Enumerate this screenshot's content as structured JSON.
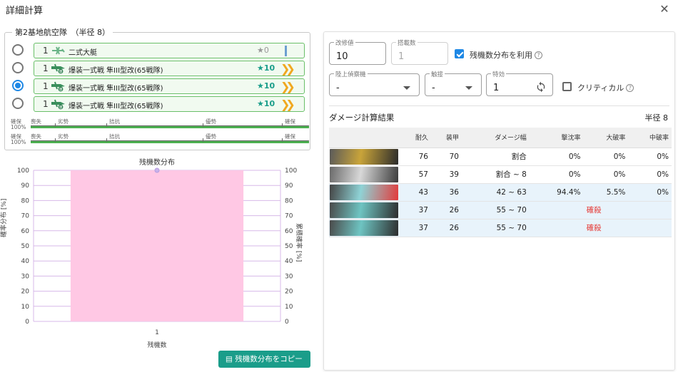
{
  "window": {
    "title": "詳細計算"
  },
  "fleet": {
    "legend": "第2基地航空隊　（半径 8）",
    "slots": [
      {
        "selected": false,
        "count": "1",
        "icon": "recon-plane-icon",
        "name": "二式大艇",
        "star": "0",
        "star_style": "grey",
        "proficiency": "",
        "proficiency_bar": true
      },
      {
        "selected": false,
        "count": "1",
        "icon": "fighter-bomber-icon",
        "name": "爆装一式戦 隼III型改(65戦隊)",
        "star": "10",
        "star_style": "teal",
        "proficiency": "❯❯",
        "proficiency_bar": false
      },
      {
        "selected": true,
        "count": "1",
        "icon": "fighter-bomber-icon",
        "name": "爆装一式戦 隼III型改(65戦隊)",
        "star": "10",
        "star_style": "teal",
        "proficiency": "❯❯",
        "proficiency_bar": false
      },
      {
        "selected": false,
        "count": "1",
        "icon": "fighter-bomber-icon",
        "name": "爆装一式戦 隼III型改(65戦隊)",
        "star": "10",
        "star_style": "teal",
        "proficiency": "❯❯",
        "proficiency_bar": false
      }
    ],
    "air_rows": [
      {
        "left": "確保",
        "left2": "100%",
        "labels": [
          "喪失",
          "劣勢",
          "拮抗",
          "優勢",
          "確保"
        ]
      },
      {
        "left": "確保",
        "left2": "100%",
        "labels": [
          "喪失",
          "劣勢",
          "拮抗",
          "優勢",
          "確保"
        ]
      }
    ]
  },
  "chart_data": {
    "type": "bar",
    "title": "残機数分布",
    "categories": [
      "1"
    ],
    "values": [
      100
    ],
    "xlabel": "残機数",
    "ylabel": "確率分布 [%]",
    "ylabel_right": "累積確率 [%]",
    "cumulative": [
      100
    ],
    "ylim": [
      0,
      100
    ],
    "yticks": [
      0,
      10,
      20,
      30,
      40,
      50,
      60,
      70,
      80,
      90,
      100
    ],
    "bar_color": "#ffc8e4",
    "grid_color": "#d7b8e8"
  },
  "copy_button": {
    "label": "残機数分布をコピー"
  },
  "settings": {
    "improvement": {
      "label": "改修値",
      "value": "10"
    },
    "slot_count": {
      "label": "搭載数",
      "value": "1"
    },
    "use_distribution": {
      "label": "残機数分布を利用",
      "checked": true
    },
    "recon": {
      "label": "陸上偵察機",
      "value": "-"
    },
    "contact": {
      "label": "触接",
      "value": "-"
    },
    "special": {
      "label": "特効",
      "value": "1"
    },
    "critical": {
      "label": "クリティカル",
      "checked": false
    }
  },
  "results": {
    "title": "ダメージ計算結果",
    "radius": "半径 8",
    "headers": [
      "",
      "耐久",
      "装甲",
      "ダメージ幅",
      "撃沈率",
      "大破率",
      "中破率"
    ],
    "rows": [
      {
        "banner": "enemy-1",
        "hp": "76",
        "armor": "70",
        "range": "割合",
        "sink": "0%",
        "heavy": "0%",
        "medium": "0%",
        "note": "",
        "highlight": false
      },
      {
        "banner": "enemy-2",
        "hp": "57",
        "armor": "39",
        "range": "割合 ~ 8",
        "sink": "0%",
        "heavy": "0%",
        "medium": "0%",
        "note": "",
        "highlight": false
      },
      {
        "banner": "enemy-3",
        "hp": "43",
        "armor": "36",
        "range": "42 ~ 63",
        "sink": "94.4%",
        "heavy": "5.5%",
        "medium": "0%",
        "note": "",
        "highlight": true
      },
      {
        "banner": "enemy-4",
        "hp": "37",
        "armor": "26",
        "range": "55 ~ 70",
        "sink": "",
        "heavy": "",
        "medium": "",
        "note": "確殺",
        "highlight": true
      },
      {
        "banner": "enemy-5",
        "hp": "37",
        "armor": "26",
        "range": "55 ~ 70",
        "sink": "",
        "heavy": "",
        "medium": "",
        "note": "確殺",
        "highlight": true
      }
    ]
  }
}
